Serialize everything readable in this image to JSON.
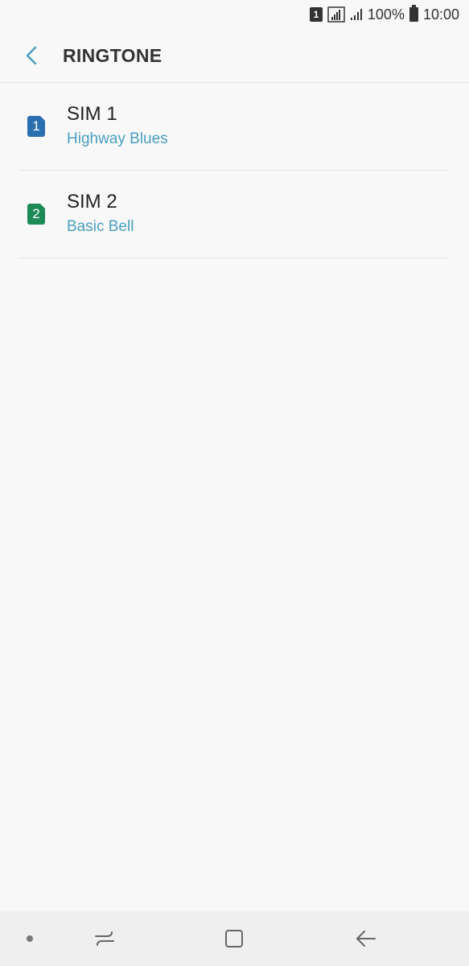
{
  "status_bar": {
    "sim_indicator": "1",
    "battery_percent": "100%",
    "time": "10:00",
    "icons": [
      "sim1-icon",
      "signal-strength-icon",
      "signal-strength-2-icon",
      "battery-icon"
    ]
  },
  "header": {
    "title": "RINGTONE",
    "back_icon": "chevron-left-icon"
  },
  "list": {
    "items": [
      {
        "badge": "1",
        "title": "SIM 1",
        "subtitle": "Highway Blues",
        "badge_color": "#2b6fb0"
      },
      {
        "badge": "2",
        "title": "SIM 2",
        "subtitle": "Basic Bell",
        "badge_color": "#1e8a57"
      }
    ]
  },
  "nav_bar": {
    "icons": [
      "nav-dot-icon",
      "recent-apps-icon",
      "home-icon",
      "back-arrow-icon"
    ]
  },
  "colors": {
    "accent": "#4a9fc0",
    "background": "#f8f8f8",
    "nav_background": "#efefef"
  }
}
